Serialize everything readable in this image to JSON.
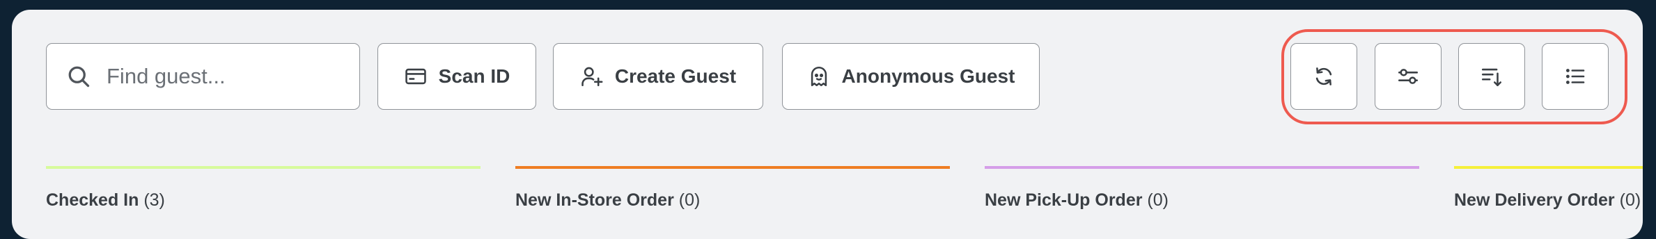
{
  "search": {
    "placeholder": "Find guest..."
  },
  "toolbar": {
    "scan_label": "Scan ID",
    "create_label": "Create Guest",
    "anonymous_label": "Anonymous Guest"
  },
  "icon_buttons": [
    {
      "icon": "refresh-icon"
    },
    {
      "icon": "filter-sliders-icon"
    },
    {
      "icon": "sort-descending-icon"
    },
    {
      "icon": "list-view-icon"
    }
  ],
  "highlight_color": "#ee5a4f",
  "columns": [
    {
      "name": "Checked In",
      "count": "(3)",
      "color": "#d7fb9b"
    },
    {
      "name": "New In-Store Order",
      "count": "(0)",
      "color": "#ef7d22"
    },
    {
      "name": "New Pick-Up Order",
      "count": "(0)",
      "color": "#d59ee8"
    },
    {
      "name": "New Delivery Order",
      "count": "(0)",
      "color": "#f5f03a"
    }
  ]
}
